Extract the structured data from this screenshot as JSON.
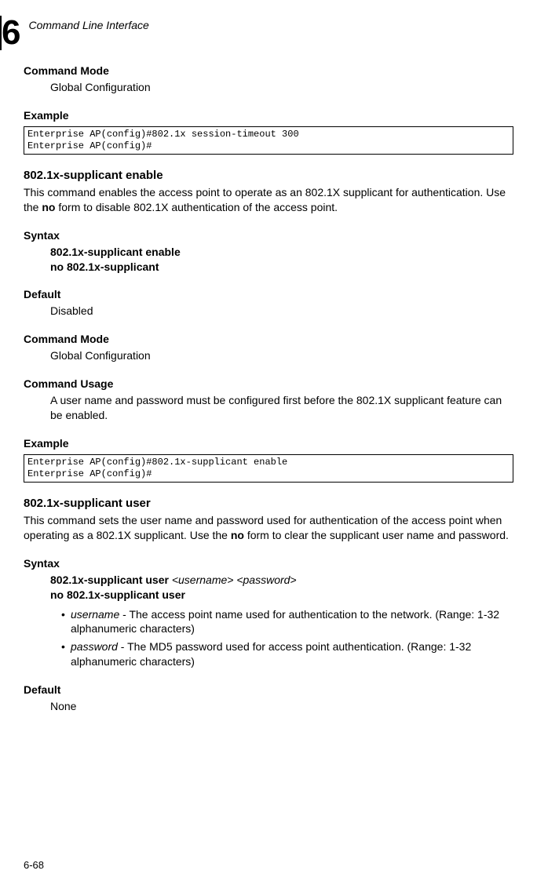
{
  "header": {
    "chapter_number": "6",
    "title": "Command Line Interface"
  },
  "sec1": {
    "cmdmode_label": "Command Mode",
    "cmdmode_text": "Global Configuration",
    "example_label": "Example",
    "code": "Enterprise AP(config)#802.1x session-timeout 300\nEnterprise AP(config)#"
  },
  "sec2": {
    "title": "802.1x-supplicant enable",
    "desc_pre": "This command enables the access point to operate as an 802.1X supplicant for authentication. Use the ",
    "desc_bold": "no",
    "desc_post": " form to disable 802.1X authentication of the access point.",
    "syntax_label": "Syntax",
    "syntax_line1": "802.1x-supplicant enable",
    "syntax_line2": "no 802.1x-supplicant",
    "default_label": "Default",
    "default_text": "Disabled",
    "cmdmode_label": "Command Mode",
    "cmdmode_text": "Global Configuration",
    "usage_label": "Command Usage",
    "usage_text": "A user name and password must be configured first before the 802.1X supplicant feature can be enabled.",
    "example_label": "Example",
    "code": "Enterprise AP(config)#802.1x-supplicant enable\nEnterprise AP(config)#"
  },
  "sec3": {
    "title": "802.1x-supplicant user",
    "desc_pre": "This command sets the user name and password used for authentication of the access point when operating as a 802.1X supplicant. Use the ",
    "desc_bold": "no",
    "desc_post": " form to clear the supplicant user name and password.",
    "syntax_label": "Syntax",
    "syntax_b1": "802.1x-supplicant user ",
    "syntax_i1": "<username> <password>",
    "syntax_line2": "no 802.1x-supplicant user",
    "bullet1_i": "username",
    "bullet1_rest": " - The access point name used for authentication to the network. (Range: 1-32 alphanumeric characters)",
    "bullet2_i": "password",
    "bullet2_rest": " - The MD5 password used for access point authentication. (Range: 1-32 alphanumeric characters)",
    "default_label": "Default",
    "default_text": "None"
  },
  "footer": "6-68"
}
